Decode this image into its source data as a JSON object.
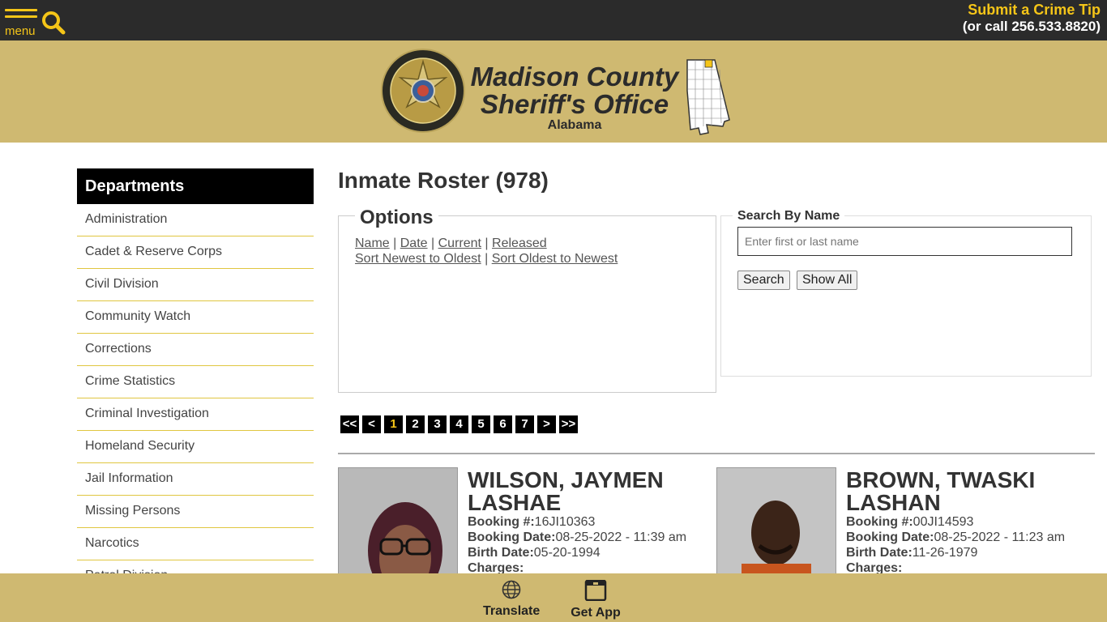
{
  "topbar": {
    "menu_label": "menu",
    "tip_link": "Submit a Crime Tip",
    "tip_phone": "(or call 256.533.8820)"
  },
  "header": {
    "line1": "Madison County",
    "line2": "Sheriff's Office",
    "line3": "Alabama",
    "seal_text_top": "MADISON COUNTY SHERIFF'S OFFICE",
    "seal_text_bottom": "ALABAMA"
  },
  "sidebar": {
    "heading": "Departments",
    "items": [
      {
        "label": "Administration"
      },
      {
        "label": "Cadet & Reserve Corps"
      },
      {
        "label": "Civil Division"
      },
      {
        "label": "Community Watch"
      },
      {
        "label": "Corrections"
      },
      {
        "label": "Crime Statistics"
      },
      {
        "label": "Criminal Investigation"
      },
      {
        "label": "Homeland Security"
      },
      {
        "label": "Jail Information"
      },
      {
        "label": "Missing Persons"
      },
      {
        "label": "Narcotics"
      },
      {
        "label": "Patrol Division"
      }
    ]
  },
  "main": {
    "title": "Inmate Roster (978)",
    "options": {
      "legend": "Options",
      "sort_name": "Name",
      "sort_date": "Date",
      "filter_current": "Current",
      "filter_released": "Released",
      "sort_newest": "Sort Newest to Oldest",
      "sort_oldest": "Sort Oldest to Newest",
      "sep": "|"
    },
    "search": {
      "legend": "Search By Name",
      "placeholder": "Enter first or last name",
      "search_button": "Search",
      "show_all_button": "Show All"
    },
    "pager": {
      "first": "<<",
      "prev": "<",
      "pages": [
        "1",
        "2",
        "3",
        "4",
        "5",
        "6",
        "7"
      ],
      "current": "1",
      "next": ">",
      "last": ">>"
    },
    "inmates": [
      {
        "name": "WILSON, JAYMEN LASHAE",
        "booking_no_label": "Booking #:",
        "booking_no": "16JI10363",
        "booking_date_label": "Booking Date:",
        "booking_date": "08-25-2022 - 11:39 am",
        "birth_date_label": "Birth Date:",
        "birth_date": "05-20-1994",
        "charges_label": "Charges:"
      },
      {
        "name": "BROWN, TWASKI LASHAN",
        "booking_no_label": "Booking #:",
        "booking_no": "00JI14593",
        "booking_date_label": "Booking Date:",
        "booking_date": "08-25-2022 - 11:23 am",
        "birth_date_label": "Birth Date:",
        "birth_date": "11-26-1979",
        "charges_label": "Charges:"
      }
    ]
  },
  "bottombar": {
    "translate": "Translate",
    "get_app": "Get App"
  },
  "colors": {
    "accent_gold": "#f5c518",
    "header_tan": "#cfb971",
    "topbar_dark": "#2b2b2b"
  }
}
